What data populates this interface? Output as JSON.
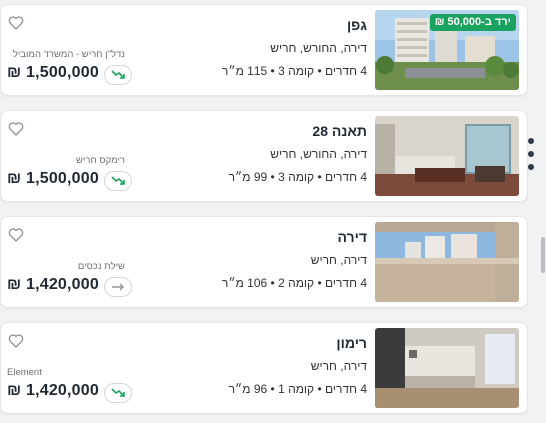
{
  "listings": [
    {
      "title": "גפן",
      "type": "דירה, החורש, חריש",
      "specs": "4 חדרים • קומה 3 • 115 מ״ר",
      "agency": "נדל\"ן חריש - המשרד המוביל",
      "price": "₪ 1,500,000",
      "trend": "down",
      "badge": "ירד ב-50,000 ₪",
      "image": "building-exterior"
    },
    {
      "title": "תאנה 28",
      "type": "דירה, החורש, חריש",
      "specs": "4 חדרים • קומה 3 • 99 מ״ר",
      "agency": "רימקס חריש",
      "price": "₪ 1,500,000",
      "trend": "down",
      "image": "living-room"
    },
    {
      "title": "דירה",
      "type": "דירה, חריש",
      "specs": "4 חדרים • קומה 2 • 106 מ״ר",
      "agency": "שילת נכסים",
      "price": "₪ 1,420,000",
      "trend": "flat",
      "image": "balcony-view"
    },
    {
      "title": "רימון",
      "type": "דירה, חריש",
      "specs": "4 חדרים • קומה 1 • 96 מ״ר",
      "agency": "Element",
      "price": "₪ 1,420,000",
      "trend": "down",
      "image": "kitchen"
    }
  ],
  "icons": {
    "favorite": "heart-outline-icon",
    "trend_down": "trend-down-icon",
    "trend_flat": "arrow-right-icon",
    "more": "vertical-dots-icon"
  },
  "colors": {
    "badge_green": "#1aa260",
    "trend_down_green": "#1aa260",
    "trend_flat_gray": "#8a9099",
    "text_dark": "#1f2933"
  }
}
